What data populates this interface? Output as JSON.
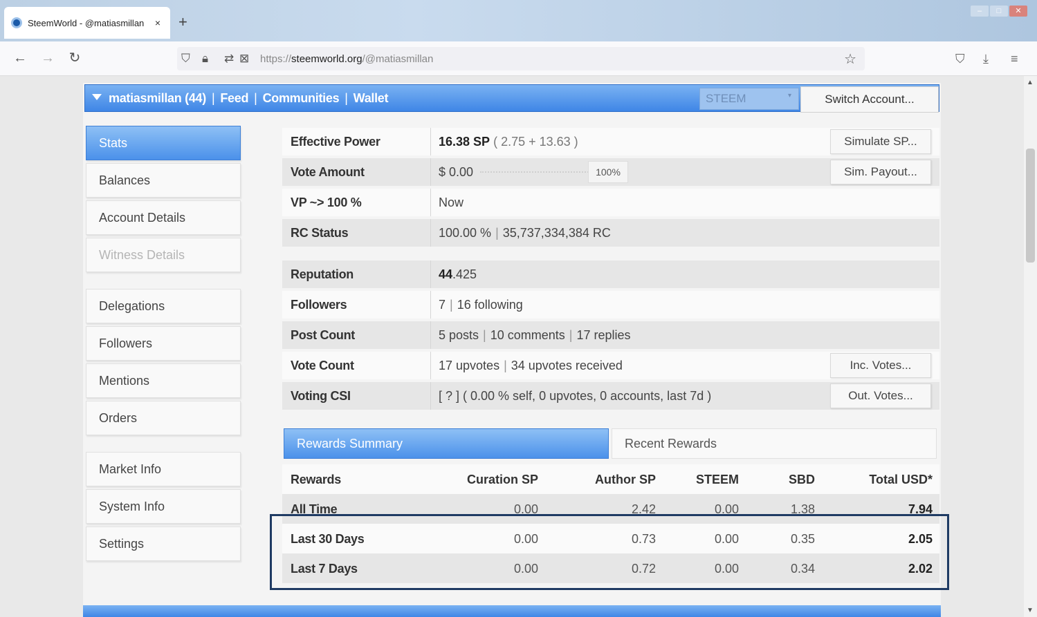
{
  "browser": {
    "tab_title": "SteemWorld - @matiasmillan",
    "tab_close": "×",
    "new_tab": "+",
    "url_prefix": "https://",
    "url_host": "steemworld.org",
    "url_path": "/@matiasmillan"
  },
  "header": {
    "nav": [
      "matiasmillan (44)",
      "Feed",
      "Communities",
      "Wallet"
    ],
    "separator": "|",
    "currency_select": "STEEM",
    "switch_account": "Switch Account..."
  },
  "sidebar": {
    "items": [
      {
        "label": "Stats"
      },
      {
        "label": "Balances"
      },
      {
        "label": "Account Details"
      },
      {
        "label": "Witness Details"
      },
      {
        "label": "Delegations"
      },
      {
        "label": "Followers"
      },
      {
        "label": "Mentions"
      },
      {
        "label": "Orders"
      },
      {
        "label": "Market Info"
      },
      {
        "label": "System Info"
      },
      {
        "label": "Settings"
      }
    ]
  },
  "stats": {
    "effective_power": {
      "label": "Effective Power",
      "value": "16.38 SP",
      "detail": "( 2.75 + 13.63 )",
      "button": "Simulate SP..."
    },
    "vote_amount": {
      "label": "Vote Amount",
      "value": "$ 0.00",
      "percent": "100%",
      "button": "Sim. Payout..."
    },
    "vp": {
      "label": "VP ~> 100 %",
      "value": "Now"
    },
    "rc_status": {
      "label": "RC Status",
      "value": "100.00 %",
      "detail": "35,737,334,384 RC"
    },
    "reputation": {
      "label": "Reputation",
      "value": "44",
      "decimals": ".425"
    },
    "followers": {
      "label": "Followers",
      "value": "7",
      "detail": "16 following"
    },
    "post_count": {
      "label": "Post Count",
      "posts": "5 posts",
      "comments": "10 comments",
      "replies": "17 replies"
    },
    "vote_count": {
      "label": "Vote Count",
      "upvotes": "17 upvotes",
      "received": "34 upvotes received",
      "button": "Inc. Votes..."
    },
    "voting_csi": {
      "label": "Voting CSI",
      "value": "[ ? ] ( 0.00 % self, 0 upvotes, 0 accounts, last 7d )",
      "button": "Out. Votes..."
    }
  },
  "rewards": {
    "tabs": [
      "Rewards Summary",
      "Recent Rewards"
    ],
    "columns": [
      "Rewards",
      "Curation SP",
      "Author SP",
      "STEEM",
      "SBD",
      "Total USD*"
    ],
    "rows": [
      [
        "All Time",
        "0.00",
        "2.42",
        "0.00",
        "1.38",
        "7.94"
      ],
      [
        "Last 30 Days",
        "0.00",
        "0.73",
        "0.00",
        "0.35",
        "2.05"
      ],
      [
        "Last 7 Days",
        "0.00",
        "0.72",
        "0.00",
        "0.34",
        "2.02"
      ]
    ]
  }
}
